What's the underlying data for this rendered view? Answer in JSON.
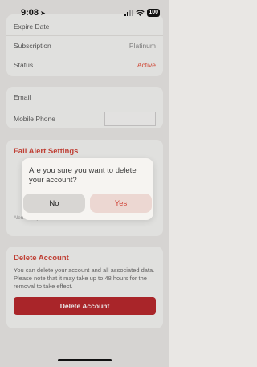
{
  "status_bar": {
    "time": "9:08",
    "battery": "100"
  },
  "subscription_card": {
    "partial_row": {
      "label": "Expire Date",
      "value": ""
    },
    "rows": [
      {
        "label": "Subscription",
        "value": "Platinum"
      },
      {
        "label": "Status",
        "value": "Active"
      }
    ]
  },
  "contact_card": {
    "email_label": "Email",
    "phone_label": "Mobile Phone"
  },
  "fall_alert": {
    "title": "Fall Alert Settings",
    "hint": "Alert history"
  },
  "delete_account": {
    "title": "Delete Account",
    "description": "You can delete your account and all associated data. Please note that it may take up to 48 hours for the removal to take effect.",
    "button_label": "Delete Account"
  },
  "dialog": {
    "message": "Are you sure you want to delete your account?",
    "no_label": "No",
    "yes_label": "Yes"
  },
  "colors": {
    "accent": "#d0463a",
    "danger": "#b8292d",
    "background": "#e9e7e4"
  }
}
